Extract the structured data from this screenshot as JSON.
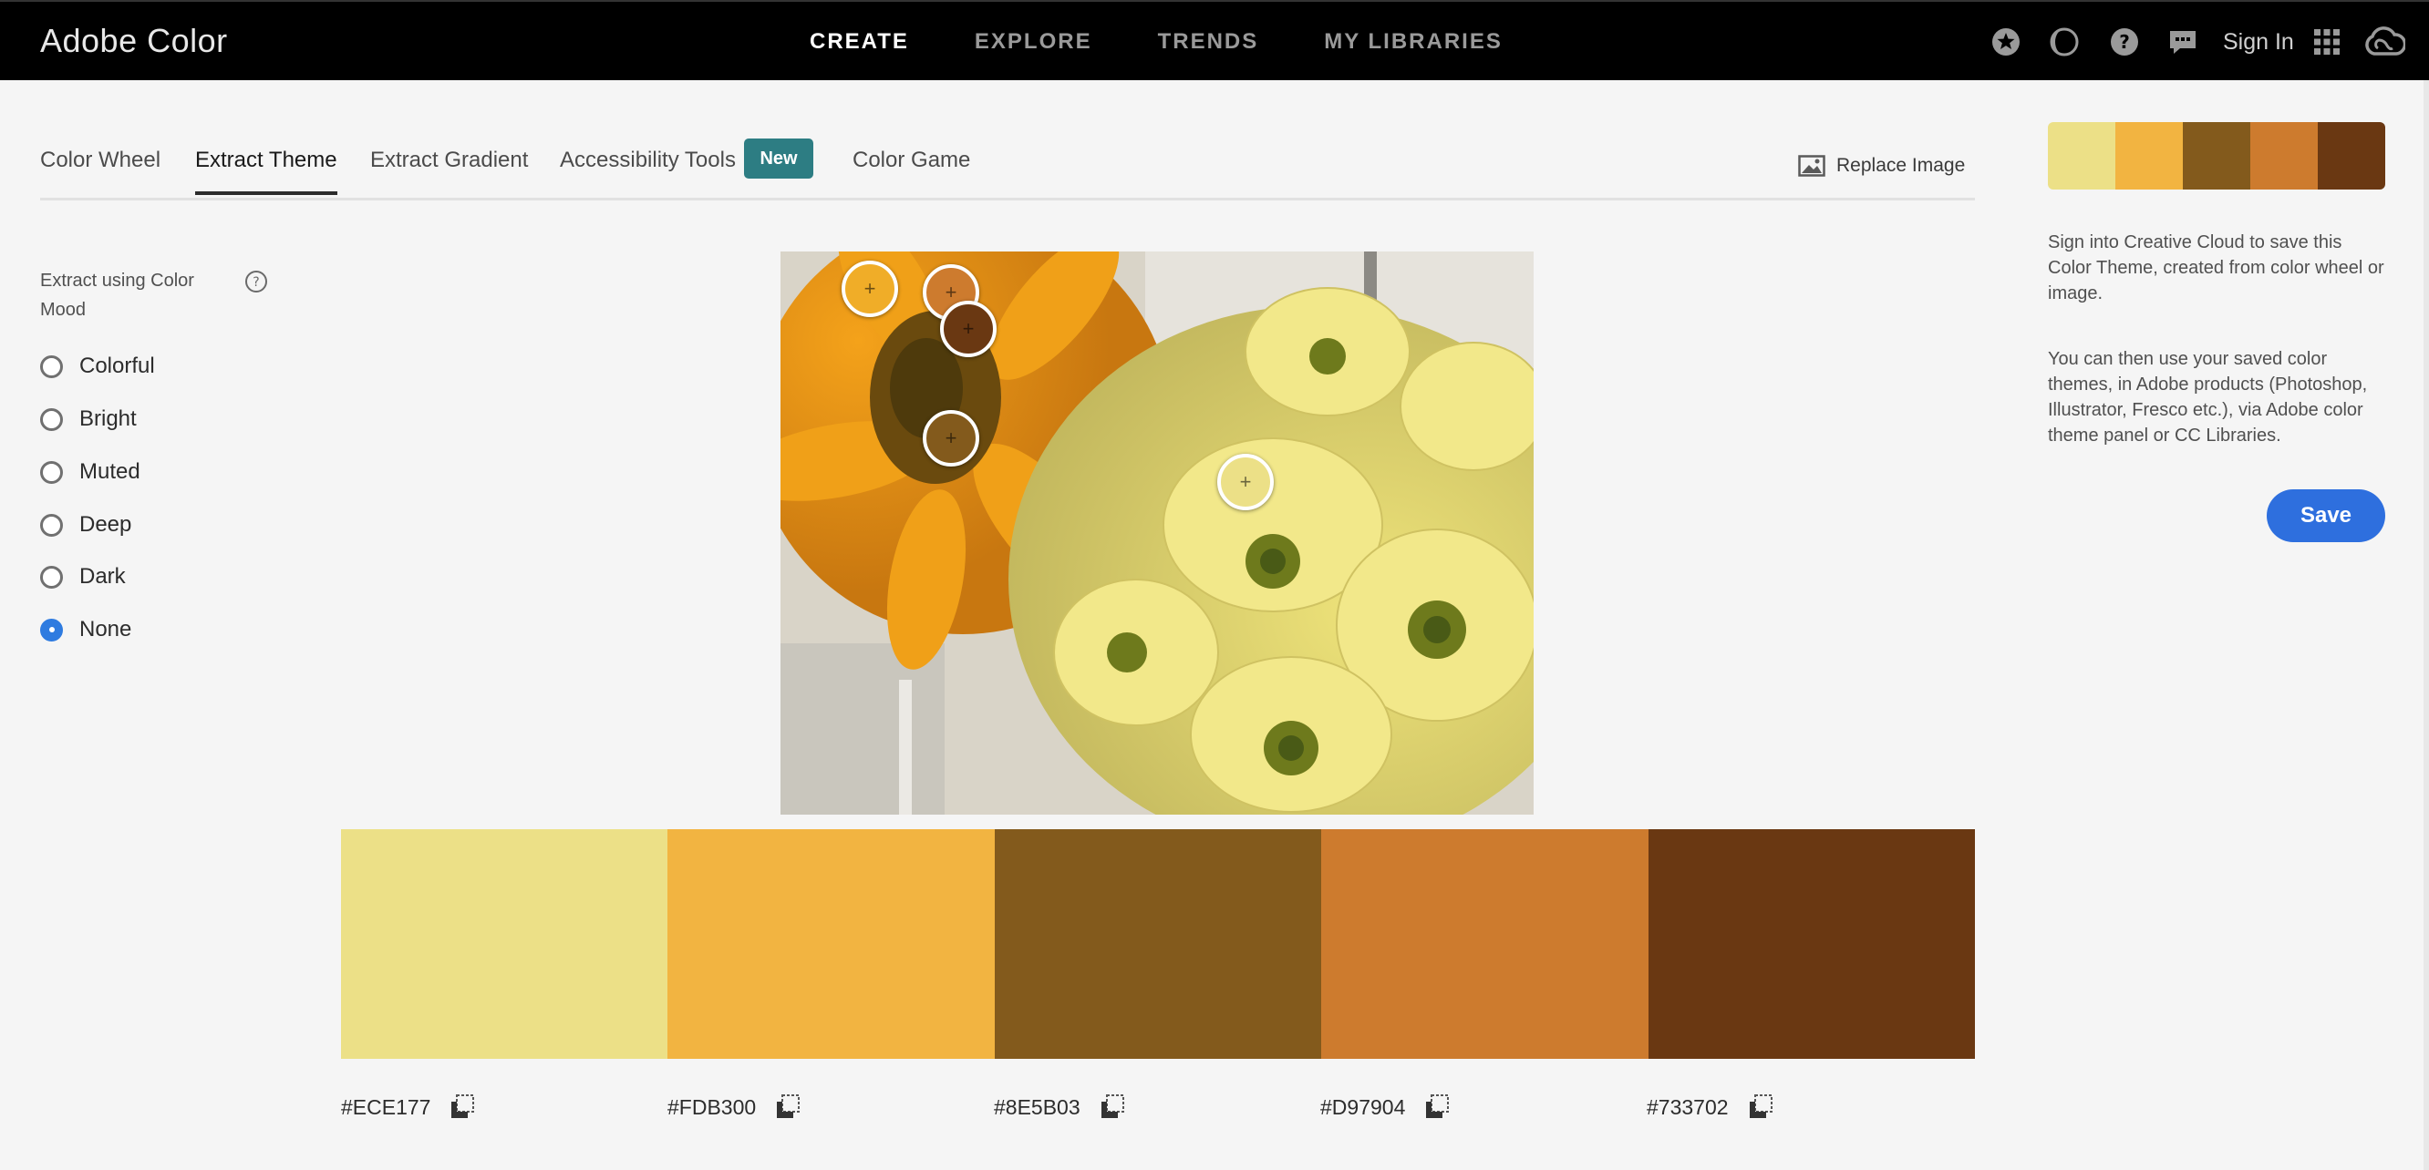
{
  "app": {
    "title": "Adobe Color"
  },
  "nav": {
    "items": [
      "CREATE",
      "EXPLORE",
      "TRENDS",
      "MY LIBRARIES"
    ],
    "active": "CREATE"
  },
  "header": {
    "sign_in": "Sign In",
    "icons": [
      "favorites-star-icon",
      "contrast-icon",
      "help-icon",
      "feedback-icon",
      "apps-grid-icon",
      "creative-cloud-icon"
    ]
  },
  "tabs": {
    "items": [
      "Color Wheel",
      "Extract Theme",
      "Extract Gradient",
      "Accessibility Tools",
      "Color Game"
    ],
    "active": "Extract Theme",
    "new_badge": "New"
  },
  "replace_image": "Replace Image",
  "mood": {
    "label": "Extract using Color Mood",
    "options": [
      "Colorful",
      "Bright",
      "Muted",
      "Deep",
      "Dark",
      "None"
    ],
    "selected": "None"
  },
  "colors": [
    {
      "hex": "#ECE177",
      "swatch": "#ece087"
    },
    {
      "hex": "#FDB300",
      "swatch": "#f2b441"
    },
    {
      "hex": "#8E5B03",
      "swatch": "#835a1c"
    },
    {
      "hex": "#D97904",
      "swatch": "#cd7b2e"
    },
    {
      "hex": "#733702",
      "swatch": "#6a3812"
    }
  ],
  "side": {
    "text1": "Sign into Creative Cloud to save this Color Theme, created from color wheel or image.",
    "text2": "You can then use your saved color themes, in Adobe products (Photoshop, Illustrator, Fresco etc.), via Adobe color theme panel or CC Libraries.",
    "save": "Save"
  },
  "accent": {
    "primary": "#2e6fde",
    "badge": "#2d7d83"
  }
}
